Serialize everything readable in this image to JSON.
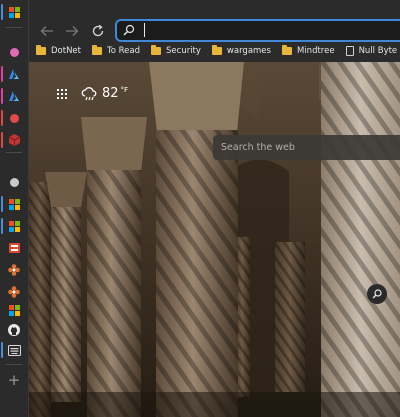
{
  "colors": {
    "accent": "#3f88d8",
    "tab_indicator": "#4c8dd6",
    "folder": "#e8b53c"
  },
  "vertical_tabs": [
    {
      "icon": "microsoft-logo-icon",
      "active": true
    },
    {
      "icon": "pink-dot-icon",
      "color": "#e36ab7"
    },
    {
      "icon": "azure-icon",
      "color": "#2b8ce8"
    },
    {
      "icon": "azure-icon",
      "color": "#2b8ce8"
    },
    {
      "icon": "red-dot-icon",
      "color": "#e24a4a"
    },
    {
      "icon": "red-cube-icon",
      "color": "#c23535"
    },
    {
      "icon": "gray-dot-icon",
      "color": "#c9c9c9"
    },
    {
      "icon": "microsoft-logo-icon"
    },
    {
      "icon": "microsoft-logo-icon"
    },
    {
      "icon": "office-icon",
      "color": "#e04a2c"
    },
    {
      "icon": "gear-flower-icon",
      "color": "#e07030"
    },
    {
      "icon": "gear-flower-icon",
      "color": "#e07030"
    },
    {
      "icon": "microsoft-logo-icon"
    },
    {
      "icon": "github-icon",
      "color": "#e8e8e8"
    },
    {
      "icon": "keyboard-icon",
      "color": "#d9d9d9"
    }
  ],
  "toolbar": {
    "address_value": "",
    "back_icon": "back-arrow-icon",
    "forward_icon": "forward-arrow-icon",
    "refresh_icon": "refresh-icon"
  },
  "bookmarks": [
    {
      "label": "DotNet",
      "icon": "folder-icon"
    },
    {
      "label": "To Read",
      "icon": "folder-icon"
    },
    {
      "label": "Security",
      "icon": "folder-icon"
    },
    {
      "label": "wargames",
      "icon": "folder-icon"
    },
    {
      "label": "Mindtree",
      "icon": "folder-icon"
    },
    {
      "label": "Null Byte - The aspi...",
      "icon": "page-icon"
    },
    {
      "label": "",
      "icon": "page-icon"
    }
  ],
  "newtab": {
    "temperature": "82",
    "unit": "°F",
    "weather_icon": "cloud-rain-icon",
    "search_placeholder": "Search the web"
  }
}
